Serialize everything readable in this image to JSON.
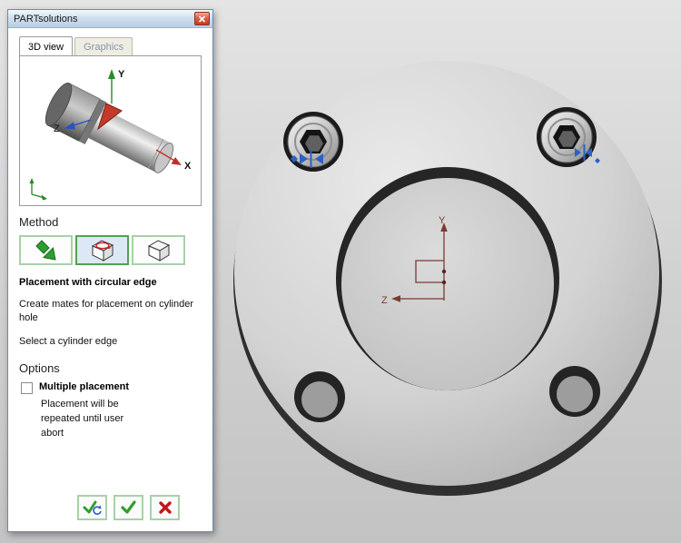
{
  "colors": {
    "dialog_border": "#6e89b8",
    "titlebar_gradient_top": "#f3f8fd",
    "titlebar_gradient_bottom": "#b9cde6",
    "close_button_red": "#c23c22",
    "method_button_border": "#a9d0a9",
    "method_selected_border": "#51a251",
    "method_selected_bg": "#dde8f6",
    "check_green": "#2f9e2f",
    "cancel_red": "#c01818",
    "sketch_red": "#7b3a30",
    "mate_arrow_blue": "#2b62c4",
    "viewport_gray": "#d0d0d0",
    "flange_dark_edge": "#2f2f2f"
  },
  "icons": {
    "close_icon": "x",
    "ok_icon": "check",
    "apply_repeat_icon": "check-with-repeat-arrow",
    "cancel_icon": "x",
    "method_insert_icon": "green-arrow",
    "method_circular_edge_icon": "cube-with-red-circle",
    "method_free_icon": "cube"
  },
  "dialog": {
    "title": "PARTsolutions",
    "tabs": [
      {
        "label": "3D view",
        "active": true
      },
      {
        "label": "Graphics",
        "active": false
      }
    ],
    "preview": {
      "axis_x": "X",
      "axis_y": "Y",
      "axis_z": "Z"
    },
    "method": {
      "heading": "Method",
      "selected_title": "Placement with circular edge",
      "description": "Create mates for placement on cylinder hole",
      "instruction": "Select a cylinder edge"
    },
    "options": {
      "heading": "Options",
      "checkbox_label": "Multiple placement",
      "checkbox_checked": false,
      "checkbox_description": "Placement will be repeated until user abort"
    }
  },
  "viewport": {
    "sketch_labels": {
      "y": "Y",
      "z": "Z"
    }
  }
}
